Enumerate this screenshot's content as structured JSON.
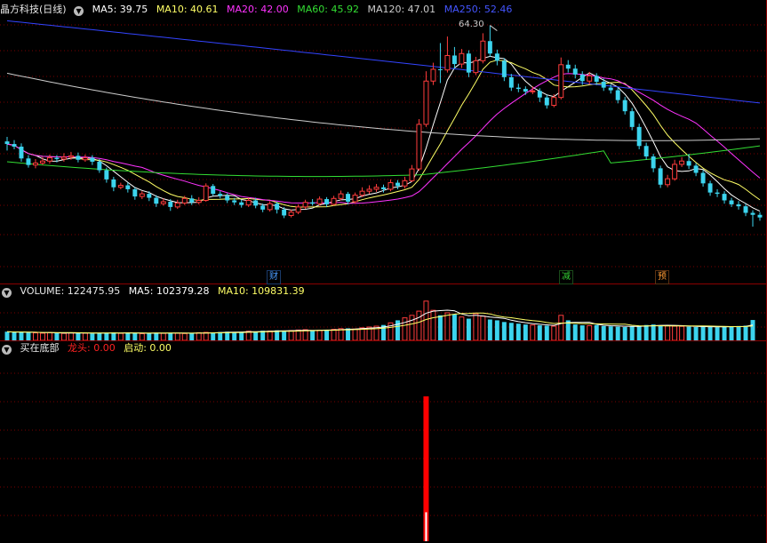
{
  "colors": {
    "bg": "#000000",
    "grid": "#7a0000",
    "divider": "#8b0000",
    "up": "#ff3c3c",
    "down": "#3cd4ee",
    "ma5": "#ffffff",
    "ma10": "#ffff66",
    "ma20": "#ff33ff",
    "ma60": "#33dd33",
    "ma120": "#cccccc",
    "ma250": "#3344ff",
    "dragon": "#ff0000",
    "start": "#ffffff"
  },
  "price_panel": {
    "stock_name": "晶方科技(日线)",
    "ma5_label": "MA5: 39.75",
    "ma10_label": "MA10: 40.61",
    "ma20_label": "MA20: 42.00",
    "ma60_label": "MA60: 45.92",
    "ma120_label": "MA120: 47.01",
    "ma250_label": "MA250: 52.46",
    "peak_label": "64.30"
  },
  "events": [
    "财",
    "减",
    "预"
  ],
  "volume_panel": {
    "volume_label": "VOLUME: 122475.95",
    "ma5_label": "MA5: 102379.28",
    "ma10_label": "MA10: 109831.39"
  },
  "indicator_panel": {
    "name": "买在底部",
    "dragon_label": "龙头: 0.00",
    "start_label": "启动: 0.00"
  },
  "chart_data": [
    {
      "type": "candlestick",
      "title": "晶方科技(日线)",
      "ylim": [
        27.5,
        66.0
      ],
      "candles": [
        [
          46.6,
          46.2,
          47.3,
          45.2
        ],
        [
          46.2,
          45.8,
          46.8,
          45.4
        ],
        [
          45.8,
          44.0,
          46.3,
          43.5
        ],
        [
          44.0,
          43.0,
          44.5,
          42.6
        ],
        [
          43.0,
          43.3,
          43.9,
          42.5
        ],
        [
          43.3,
          43.6,
          44.2,
          43.0
        ],
        [
          43.6,
          44.1,
          44.6,
          43.2
        ],
        [
          44.1,
          43.9,
          44.5,
          43.4
        ],
        [
          43.9,
          44.2,
          44.8,
          43.5
        ],
        [
          44.2,
          44.4,
          45.0,
          43.8
        ],
        [
          44.4,
          43.8,
          44.9,
          43.4
        ],
        [
          43.8,
          44.1,
          44.6,
          43.5
        ],
        [
          44.1,
          43.5,
          44.5,
          43.0
        ],
        [
          43.5,
          42.2,
          43.9,
          41.8
        ],
        [
          42.2,
          40.8,
          42.6,
          40.3
        ],
        [
          40.8,
          39.6,
          41.2,
          39.0
        ],
        [
          39.6,
          39.9,
          40.3,
          39.3
        ],
        [
          39.9,
          39.3,
          40.3,
          38.8
        ],
        [
          39.3,
          38.2,
          39.6,
          37.7
        ],
        [
          38.2,
          38.6,
          39.0,
          37.8
        ],
        [
          38.6,
          38.0,
          39.0,
          37.5
        ],
        [
          38.0,
          37.1,
          38.4,
          36.6
        ],
        [
          37.1,
          37.4,
          37.9,
          36.8
        ],
        [
          37.4,
          36.6,
          37.8,
          36.0
        ],
        [
          36.6,
          37.2,
          37.7,
          36.3
        ],
        [
          37.2,
          37.9,
          38.3,
          36.9
        ],
        [
          37.9,
          37.3,
          38.4,
          36.9
        ],
        [
          37.3,
          37.6,
          38.1,
          37.0
        ],
        [
          37.6,
          39.8,
          40.2,
          37.4
        ],
        [
          39.8,
          38.6,
          40.1,
          38.3
        ],
        [
          38.6,
          38.3,
          39.0,
          37.9
        ],
        [
          38.3,
          37.6,
          38.7,
          37.2
        ],
        [
          37.6,
          37.3,
          38.0,
          36.9
        ],
        [
          37.3,
          36.9,
          37.7,
          36.5
        ],
        [
          36.9,
          37.6,
          38.0,
          36.6
        ],
        [
          37.6,
          36.8,
          38.0,
          36.4
        ],
        [
          36.8,
          36.2,
          37.1,
          35.8
        ],
        [
          36.2,
          37.1,
          37.5,
          35.9
        ],
        [
          37.1,
          36.2,
          37.4,
          35.6
        ],
        [
          36.2,
          35.3,
          36.6,
          34.9
        ],
        [
          35.3,
          35.8,
          36.2,
          35.0
        ],
        [
          35.8,
          36.6,
          37.0,
          35.5
        ],
        [
          36.6,
          37.3,
          37.7,
          36.3
        ],
        [
          37.3,
          37.1,
          37.8,
          36.8
        ],
        [
          37.1,
          37.8,
          38.2,
          36.8
        ],
        [
          37.8,
          37.0,
          38.1,
          36.6
        ],
        [
          37.0,
          37.9,
          38.3,
          36.8
        ],
        [
          37.9,
          38.6,
          39.1,
          37.6
        ],
        [
          38.6,
          37.4,
          38.9,
          37.0
        ],
        [
          37.4,
          38.4,
          38.8,
          37.1
        ],
        [
          38.4,
          39.0,
          39.6,
          38.1
        ],
        [
          39.0,
          39.3,
          39.9,
          38.6
        ],
        [
          39.3,
          39.6,
          40.1,
          38.9
        ],
        [
          39.6,
          39.3,
          40.0,
          38.8
        ],
        [
          39.3,
          40.3,
          40.8,
          39.0
        ],
        [
          40.3,
          39.8,
          40.7,
          39.3
        ],
        [
          39.8,
          40.6,
          41.2,
          39.4
        ],
        [
          40.6,
          42.4,
          43.0,
          40.4
        ],
        [
          42.4,
          49.2,
          50.0,
          42.1
        ],
        [
          49.2,
          55.8,
          57.3,
          48.8
        ],
        [
          55.8,
          57.6,
          58.6,
          55.2
        ],
        [
          57.6,
          57.5,
          61.6,
          55.5
        ],
        [
          57.5,
          59.7,
          62.6,
          57.1
        ],
        [
          59.7,
          58.4,
          61.0,
          57.7
        ],
        [
          58.4,
          60.0,
          60.7,
          57.8
        ],
        [
          60.0,
          57.1,
          60.5,
          56.4
        ],
        [
          57.1,
          58.9,
          59.5,
          56.7
        ],
        [
          58.9,
          61.9,
          63.1,
          58.5
        ],
        [
          61.9,
          60.0,
          64.3,
          59.5
        ],
        [
          60.0,
          58.9,
          60.6,
          58.2
        ],
        [
          58.9,
          56.4,
          59.3,
          55.8
        ],
        [
          56.4,
          54.8,
          56.9,
          54.3
        ],
        [
          54.8,
          54.6,
          55.4,
          54.1
        ],
        [
          54.6,
          54.2,
          55.0,
          53.7
        ],
        [
          54.2,
          54.3,
          55.0,
          53.8
        ],
        [
          54.3,
          53.3,
          54.7,
          52.6
        ],
        [
          53.3,
          52.1,
          53.7,
          51.6
        ],
        [
          52.1,
          53.3,
          53.8,
          51.8
        ],
        [
          53.3,
          58.3,
          59.4,
          53.0
        ],
        [
          58.3,
          57.7,
          59.0,
          57.1
        ],
        [
          57.7,
          56.8,
          58.3,
          56.2
        ],
        [
          56.8,
          55.8,
          57.3,
          55.2
        ],
        [
          55.8,
          56.6,
          57.2,
          55.3
        ],
        [
          56.6,
          55.7,
          57.0,
          55.2
        ],
        [
          55.7,
          54.8,
          56.2,
          54.3
        ],
        [
          54.8,
          54.4,
          55.3,
          53.9
        ],
        [
          54.4,
          52.9,
          54.8,
          52.4
        ],
        [
          52.9,
          51.2,
          53.4,
          50.7
        ],
        [
          51.2,
          48.8,
          51.7,
          48.3
        ],
        [
          48.8,
          45.9,
          49.3,
          45.4
        ],
        [
          45.9,
          44.3,
          46.4,
          43.8
        ],
        [
          44.3,
          42.5,
          44.7,
          41.9
        ],
        [
          42.5,
          40.0,
          42.9,
          39.5
        ],
        [
          40.0,
          40.9,
          41.5,
          39.6
        ],
        [
          40.9,
          43.1,
          43.8,
          40.6
        ],
        [
          43.1,
          43.6,
          44.2,
          42.7
        ],
        [
          43.6,
          42.9,
          44.7,
          42.4
        ],
        [
          42.9,
          41.8,
          43.3,
          41.3
        ],
        [
          41.8,
          40.2,
          42.2,
          39.7
        ],
        [
          40.2,
          38.8,
          40.6,
          38.3
        ],
        [
          38.8,
          38.6,
          39.3,
          38.1
        ],
        [
          38.6,
          37.6,
          39.0,
          37.1
        ],
        [
          37.6,
          37.0,
          38.0,
          36.6
        ],
        [
          37.0,
          36.7,
          37.5,
          36.2
        ],
        [
          36.7,
          35.7,
          37.1,
          35.2
        ],
        [
          35.7,
          35.4,
          36.1,
          33.6
        ],
        [
          35.4,
          35.0,
          35.8,
          34.5
        ]
      ]
    },
    {
      "type": "bar",
      "title": "VOLUME",
      "ylim": [
        0,
        250000
      ],
      "values": [
        52000,
        48000,
        50000,
        47000,
        45000,
        43000,
        46000,
        44000,
        42000,
        45000,
        47000,
        43000,
        41000,
        44000,
        46000,
        48000,
        42000,
        45000,
        43000,
        40000,
        44000,
        46000,
        42000,
        45000,
        43000,
        41000,
        44000,
        46000,
        48000,
        47000,
        50000,
        52000,
        49000,
        51000,
        55000,
        53000,
        58000,
        56000,
        60000,
        57000,
        59000,
        62000,
        64000,
        58000,
        61000,
        63000,
        66000,
        70000,
        72000,
        68000,
        75000,
        80000,
        85000,
        92000,
        105000,
        120000,
        135000,
        150000,
        175000,
        235000,
        180000,
        150000,
        165000,
        155000,
        140000,
        130000,
        160000,
        145000,
        125000,
        120000,
        110000,
        105000,
        100000,
        95000,
        92000,
        90000,
        88000,
        85000,
        150000,
        120000,
        95000,
        90000,
        88000,
        92000,
        86000,
        84000,
        82000,
        80000,
        85000,
        88000,
        92000,
        95000,
        90000,
        87000,
        85000,
        84000,
        82000,
        80000,
        82000,
        81000,
        79000,
        83000,
        84000,
        86000,
        88000,
        122000
      ]
    },
    {
      "type": "bar",
      "title": "买在底部",
      "series": [
        {
          "name": "龙头",
          "values": [
            0,
            0,
            0,
            0,
            0,
            0,
            0,
            0,
            0,
            0,
            0,
            0,
            0,
            0,
            0,
            0,
            0,
            0,
            0,
            0,
            0,
            0,
            0,
            0,
            0,
            0,
            0,
            0,
            0,
            0,
            0,
            0,
            0,
            0,
            0,
            0,
            0,
            0,
            0,
            0,
            0,
            0,
            0,
            0,
            0,
            0,
            0,
            0,
            0,
            0,
            0,
            0,
            0,
            0,
            0,
            0,
            0,
            0,
            0,
            0.1,
            0,
            0,
            0,
            0,
            0,
            0,
            0,
            0,
            0,
            0,
            0,
            0,
            0,
            0,
            0,
            0,
            0,
            0,
            0,
            0,
            0,
            0,
            0,
            0,
            0,
            0,
            0,
            0,
            0,
            0,
            0,
            0,
            0,
            0,
            0,
            0,
            0,
            0,
            0,
            0,
            0,
            0,
            0,
            0,
            0,
            0,
            0,
            0
          ]
        },
        {
          "name": "启动",
          "values": [
            0,
            0,
            0,
            0,
            0,
            0,
            0,
            0,
            0,
            0,
            0,
            0,
            0,
            0,
            0,
            0,
            0,
            0,
            0,
            0,
            0,
            0,
            0,
            0,
            0,
            0,
            0,
            0,
            0,
            0,
            0,
            0,
            0,
            0,
            0,
            0,
            0,
            0,
            0,
            0,
            0,
            0,
            0,
            0,
            0,
            0,
            0,
            0,
            0,
            0,
            0,
            0,
            0,
            0,
            0,
            0,
            0,
            0,
            0,
            0.02,
            0,
            0,
            0,
            0,
            0,
            0,
            0,
            0,
            0,
            0,
            0,
            0,
            0,
            0,
            0,
            0,
            0,
            0,
            0,
            0,
            0,
            0,
            0,
            0,
            0,
            0,
            0,
            0,
            0,
            0,
            0,
            0,
            0,
            0,
            0,
            0,
            0,
            0,
            0,
            0,
            0,
            0,
            0,
            0,
            0,
            0,
            0,
            0
          ]
        }
      ],
      "ylim": [
        0,
        0.1
      ]
    }
  ]
}
